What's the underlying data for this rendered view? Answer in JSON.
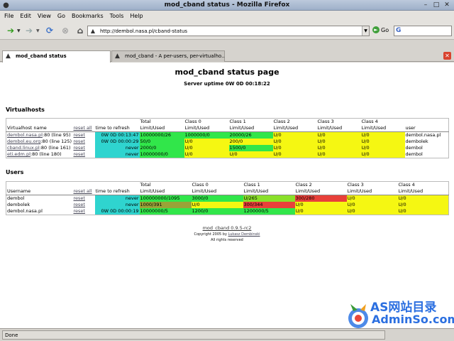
{
  "window": {
    "title": "mod_cband status - Mozilla Firefox"
  },
  "menu": [
    {
      "label": "File",
      "key": "F"
    },
    {
      "label": "Edit",
      "key": "E"
    },
    {
      "label": "View",
      "key": "V"
    },
    {
      "label": "Go",
      "key": "G"
    },
    {
      "label": "Bookmarks",
      "key": "B"
    },
    {
      "label": "Tools",
      "key": "T"
    },
    {
      "label": "Help",
      "key": "H"
    }
  ],
  "nav": {
    "url": "http://dembol.nasa.pl/cband-status",
    "go_label": "Go",
    "search_glyph": "G"
  },
  "tabs": [
    {
      "label": "mod_cband status",
      "active": true
    },
    {
      "label": "mod_cband - A per-users, per-virtualho...",
      "active": false
    }
  ],
  "page": {
    "title": "mod_cband status page",
    "uptime": "Server uptime 0W 0D 00:18:22",
    "vh_heading": "Virtualhosts",
    "users_heading": "Users",
    "reset_all": "reset all",
    "reset": "reset"
  },
  "vh_table": {
    "headers": {
      "name": "Virtualhost name",
      "refresh": "time to refresh",
      "total": [
        "Total",
        "Limit/Used"
      ],
      "c0": [
        "Class 0",
        "Limit/Used"
      ],
      "c1": [
        "Class 1",
        "Limit/Used"
      ],
      "c2": [
        "Class 2",
        "Limit/Used"
      ],
      "c3": [
        "Class 3",
        "Limit/Used"
      ],
      "c4": [
        "Class 4",
        "Limit/Used"
      ],
      "user": "user"
    },
    "rows": [
      {
        "host": "dembol.nasa.pl",
        "line": ":80 (line 95)",
        "refresh": "0W 0D 00:13:47",
        "total": "10000000/26",
        "c0": "1000000/0",
        "c1": "20000/26",
        "c2": "U/0",
        "c3": "U/0",
        "c4": "U/0",
        "user": "dembol.nasa.pl"
      },
      {
        "host": "dembol.eu.org",
        "line": ":80 (line 125)",
        "refresh": "0W 0D 00:00:29",
        "total": "50/0",
        "c0": "U/0",
        "c1": "200/0",
        "c2": "U/0",
        "c3": "U/0",
        "c4": "U/0",
        "user": "dembolek"
      },
      {
        "host": "cband.linux.pl",
        "line": ":80 (line 161)",
        "refresh": "never",
        "total": "2000/0",
        "c0": "U/0",
        "c1": "1500/0",
        "c2": "U/0",
        "c3": "U/0",
        "c4": "U/0",
        "user": "dembol"
      },
      {
        "host": "eti.edm.pl",
        "line": ":80 (line 180)",
        "refresh": "never",
        "total": "10000000/0",
        "c0": "U/0",
        "c1": "U/0",
        "c2": "U/0",
        "c3": "U/0",
        "c4": "U/0",
        "user": "dembol"
      }
    ]
  },
  "users_table": {
    "headers": {
      "name": "Username",
      "refresh": "time to refresh",
      "total": [
        "Total",
        "Limit/Used"
      ],
      "c0": [
        "Class 0",
        "Limit/Used"
      ],
      "c1": [
        "Class 1",
        "Limit/Used"
      ],
      "c2": [
        "Class 2",
        "Limit/Used"
      ],
      "c3": [
        "Class 3",
        "Limit/Used"
      ],
      "c4": [
        "Class 4",
        "Limit/Used"
      ]
    },
    "rows": [
      {
        "user": "dembol",
        "refresh": "never",
        "total": "100000000/1095",
        "c0": "3000/0",
        "c1": "U/265",
        "c2": "300/280",
        "c3": "U/0",
        "c4": "U/0"
      },
      {
        "user": "dembolek",
        "refresh": "never",
        "total": "1000/391",
        "c0": "U/0",
        "c1": "300/344",
        "c2": "U/0",
        "c3": "U/0",
        "c4": "U/0"
      },
      {
        "user": "dembol.nasa.pl",
        "refresh": "0W 0D 00:00:19",
        "total": "10000000/5",
        "c0": "1200/0",
        "c1": "1200000/5",
        "c2": "U/0",
        "c3": "U/0",
        "c4": "U/0"
      }
    ]
  },
  "footer": {
    "version": "mod_cband 0.9.5-rc2",
    "copyright_prefix": "Copyright 2005 by",
    "author": "Lukasz Dembinski",
    "rights": "All rights reserved"
  },
  "watermark": {
    "line1": "AS网站目录",
    "line2": "AdminSo.com"
  },
  "status": {
    "text": "Done"
  },
  "colors": {
    "cyan": "#2fd4cf",
    "green": "#31e64a",
    "yellow": "#f5f712",
    "red": "#e8403a",
    "olive": "#9aa338",
    "lightgreen": "#8ae02a"
  }
}
